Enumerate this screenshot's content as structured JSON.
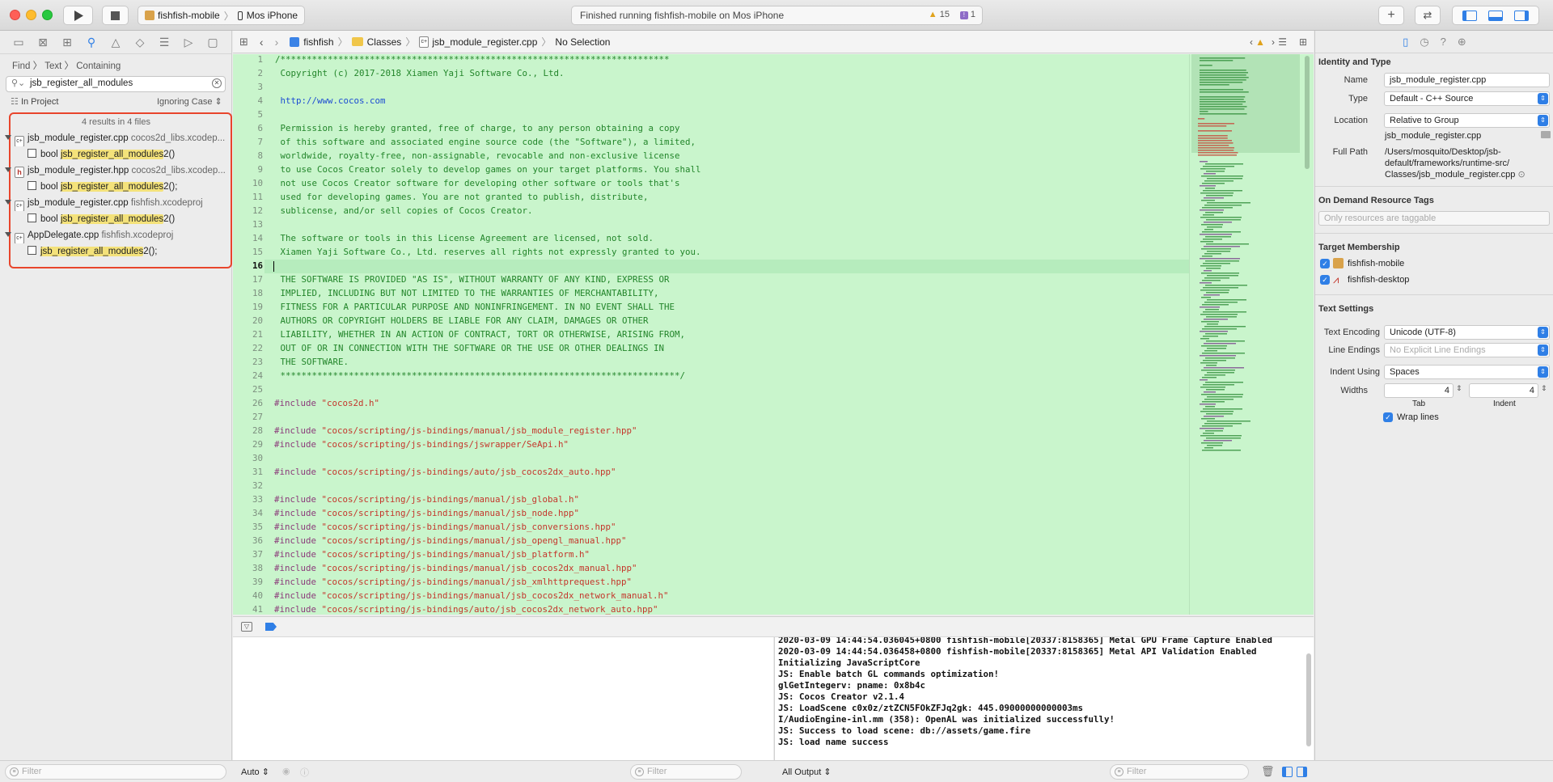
{
  "toolbar": {
    "scheme_target": "fishfish-mobile",
    "scheme_device": "Mos iPhone",
    "status_text": "Finished running fishfish-mobile on Mos iPhone",
    "warnings": "15",
    "errors": "1"
  },
  "navigator": {
    "breadcrumb": [
      "Find",
      "Text",
      "Containing"
    ],
    "search_value": "jsb_register_all_modules",
    "scope": "In Project",
    "match_mode": "Ignoring Case",
    "results_summary": "4 results in 4 files",
    "results": [
      {
        "file": "jsb_module_register.cpp",
        "project": "cocos2d_libs.xcodep...",
        "icon": "c++",
        "match_prefix": "bool ",
        "match": "jsb_register_all_modules",
        "match_suffix": "2()"
      },
      {
        "file": "jsb_module_register.hpp",
        "project": "cocos2d_libs.xcodep...",
        "icon": "h",
        "match_prefix": "bool ",
        "match": "jsb_register_all_modules",
        "match_suffix": "2();"
      },
      {
        "file": "jsb_module_register.cpp",
        "project": "fishfish.xcodeproj",
        "icon": "c++",
        "match_prefix": "bool ",
        "match": "jsb_register_all_modules",
        "match_suffix": "2()"
      },
      {
        "file": "AppDelegate.cpp",
        "project": "fishfish.xcodeproj",
        "icon": "c++",
        "match_prefix": "",
        "match": "jsb_register_all_modules",
        "match_suffix": "2();"
      }
    ],
    "filter_placeholder": "Filter"
  },
  "editor": {
    "path": [
      "fishfish",
      "Classes",
      "jsb_module_register.cpp",
      "No Selection"
    ],
    "current_line": 16,
    "lines": [
      {
        "n": 1,
        "t": "/**************************************************************************",
        "k": "c"
      },
      {
        "n": 2,
        "t": " Copyright (c) 2017-2018 Xiamen Yaji Software Co., Ltd.",
        "k": "c"
      },
      {
        "n": 3,
        "t": "",
        "k": "c"
      },
      {
        "n": 4,
        "t": " http://www.cocos.com",
        "k": "u"
      },
      {
        "n": 5,
        "t": "",
        "k": "c"
      },
      {
        "n": 6,
        "t": " Permission is hereby granted, free of charge, to any person obtaining a copy",
        "k": "c"
      },
      {
        "n": 7,
        "t": " of this software and associated engine source code (the \"Software\"), a limited,",
        "k": "c"
      },
      {
        "n": 8,
        "t": " worldwide, royalty-free, non-assignable, revocable and non-exclusive license",
        "k": "c"
      },
      {
        "n": 9,
        "t": " to use Cocos Creator solely to develop games on your target platforms. You shall",
        "k": "c"
      },
      {
        "n": 10,
        "t": " not use Cocos Creator software for developing other software or tools that's",
        "k": "c"
      },
      {
        "n": 11,
        "t": " used for developing games. You are not granted to publish, distribute,",
        "k": "c"
      },
      {
        "n": 12,
        "t": " sublicense, and/or sell copies of Cocos Creator.",
        "k": "c"
      },
      {
        "n": 13,
        "t": "",
        "k": "c"
      },
      {
        "n": 14,
        "t": " The software or tools in this License Agreement are licensed, not sold.",
        "k": "c"
      },
      {
        "n": 15,
        "t": " Xiamen Yaji Software Co., Ltd. reserves all rights not expressly granted to you.",
        "k": "c"
      },
      {
        "n": 16,
        "t": "",
        "k": "c"
      },
      {
        "n": 17,
        "t": " THE SOFTWARE IS PROVIDED \"AS IS\", WITHOUT WARRANTY OF ANY KIND, EXPRESS OR",
        "k": "c"
      },
      {
        "n": 18,
        "t": " IMPLIED, INCLUDING BUT NOT LIMITED TO THE WARRANTIES OF MERCHANTABILITY,",
        "k": "c"
      },
      {
        "n": 19,
        "t": " FITNESS FOR A PARTICULAR PURPOSE AND NONINFRINGEMENT. IN NO EVENT SHALL THE",
        "k": "c"
      },
      {
        "n": 20,
        "t": " AUTHORS OR COPYRIGHT HOLDERS BE LIABLE FOR ANY CLAIM, DAMAGES OR OTHER",
        "k": "c"
      },
      {
        "n": 21,
        "t": " LIABILITY, WHETHER IN AN ACTION OF CONTRACT, TORT OR OTHERWISE, ARISING FROM,",
        "k": "c"
      },
      {
        "n": 22,
        "t": " OUT OF OR IN CONNECTION WITH THE SOFTWARE OR THE USE OR OTHER DEALINGS IN",
        "k": "c"
      },
      {
        "n": 23,
        "t": " THE SOFTWARE.",
        "k": "c"
      },
      {
        "n": 24,
        "t": " ****************************************************************************/",
        "k": "c"
      },
      {
        "n": 25,
        "t": "",
        "k": "c"
      },
      {
        "n": 26,
        "t": "\"cocos2d.h\"",
        "k": "i"
      },
      {
        "n": 27,
        "t": "",
        "k": "c"
      },
      {
        "n": 28,
        "t": "\"cocos/scripting/js-bindings/manual/jsb_module_register.hpp\"",
        "k": "i"
      },
      {
        "n": 29,
        "t": "\"cocos/scripting/js-bindings/jswrapper/SeApi.h\"",
        "k": "i"
      },
      {
        "n": 30,
        "t": "",
        "k": "c"
      },
      {
        "n": 31,
        "t": "\"cocos/scripting/js-bindings/auto/jsb_cocos2dx_auto.hpp\"",
        "k": "i"
      },
      {
        "n": 32,
        "t": "",
        "k": "c"
      },
      {
        "n": 33,
        "t": "\"cocos/scripting/js-bindings/manual/jsb_global.h\"",
        "k": "i"
      },
      {
        "n": 34,
        "t": "\"cocos/scripting/js-bindings/manual/jsb_node.hpp\"",
        "k": "i"
      },
      {
        "n": 35,
        "t": "\"cocos/scripting/js-bindings/manual/jsb_conversions.hpp\"",
        "k": "i"
      },
      {
        "n": 36,
        "t": "\"cocos/scripting/js-bindings/manual/jsb_opengl_manual.hpp\"",
        "k": "i"
      },
      {
        "n": 37,
        "t": "\"cocos/scripting/js-bindings/manual/jsb_platform.h\"",
        "k": "i"
      },
      {
        "n": 38,
        "t": "\"cocos/scripting/js-bindings/manual/jsb_cocos2dx_manual.hpp\"",
        "k": "i"
      },
      {
        "n": 39,
        "t": "\"cocos/scripting/js-bindings/manual/jsb_xmlhttprequest.hpp\"",
        "k": "i"
      },
      {
        "n": 40,
        "t": "\"cocos/scripting/js-bindings/manual/jsb_cocos2dx_network_manual.h\"",
        "k": "i"
      },
      {
        "n": 41,
        "t": "\"cocos/scripting/js-bindings/auto/jsb_cocos2dx_network_auto.hpp\"",
        "k": "i"
      }
    ],
    "include_kw": "#include"
  },
  "inspector": {
    "identity_title": "Identity and Type",
    "name_label": "Name",
    "name_value": "jsb_module_register.cpp",
    "type_label": "Type",
    "type_value": "Default - C++ Source",
    "location_label": "Location",
    "location_value": "Relative to Group",
    "location_file": "jsb_module_register.cpp",
    "fullpath_label": "Full Path",
    "fullpath_lines": [
      "/Users/mosquito/Desktop/jsb-",
      "default/frameworks/runtime-src/",
      "Classes/jsb_module_register.cpp"
    ],
    "odr_title": "On Demand Resource Tags",
    "odr_placeholder": "Only resources are taggable",
    "target_title": "Target Membership",
    "targets": [
      "fishfish-mobile",
      "fishfish-desktop"
    ],
    "text_title": "Text Settings",
    "encoding_label": "Text Encoding",
    "encoding_value": "Unicode (UTF-8)",
    "lineend_label": "Line Endings",
    "lineend_value": "No Explicit Line Endings",
    "indent_label": "Indent Using",
    "indent_value": "Spaces",
    "widths_label": "Widths",
    "tab_value": "4",
    "indent_value_num": "4",
    "tab_label": "Tab",
    "indent_sub_label": "Indent",
    "wrap_label": "Wrap lines"
  },
  "console": {
    "lines": [
      "2020-03-09 14:44:54.036045+0800 fishfish-mobile[20337:8158365] Metal GPU Frame Capture Enabled",
      "2020-03-09 14:44:54.036458+0800 fishfish-mobile[20337:8158365] Metal API Validation Enabled",
      "Initializing JavaScriptCore",
      "JS: Enable batch GL commands optimization!",
      "glGetIntegerv: pname: 0x8b4c",
      "JS: Cocos Creator v2.1.4",
      "JS: LoadScene c0x0z/ztZCN5FOkZFJq2gk: 445.09000000000003ms",
      "I/AudioEngine-inl.mm (358): OpenAL was initialized successfully!",
      "JS: Success to load scene: db://assets/game.fire",
      "JS: load name success"
    ],
    "output_selector": "All Output",
    "auto_selector": "Auto",
    "filter_placeholder": "Filter"
  },
  "colors": {
    "editor_bg": "#c9f5cc",
    "comment": "#22852a",
    "string": "#c4362b",
    "keyword": "#8b3a7a",
    "highlight_box": "#e8452c",
    "accent": "#2f7fe6"
  }
}
